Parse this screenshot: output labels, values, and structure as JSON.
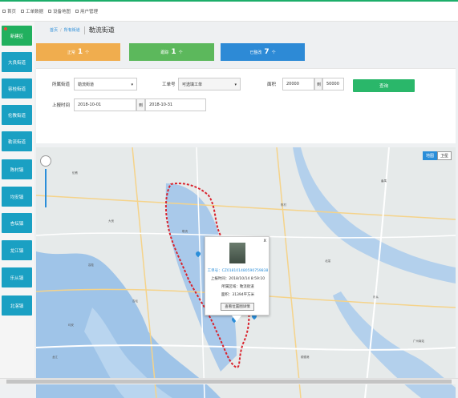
{
  "topbar": {
    "tabs": [
      {
        "label": "首页"
      },
      {
        "label": "工单数据"
      },
      {
        "label": "设备地图"
      },
      {
        "label": "用户管理"
      }
    ]
  },
  "sidebar": {
    "items": [
      {
        "label": "新建区"
      },
      {
        "label": "大良街道"
      },
      {
        "label": "容桂街道"
      },
      {
        "label": "伦教街道"
      },
      {
        "label": "勒流街道"
      },
      {
        "label": "陈村镇"
      },
      {
        "label": "均安镇"
      },
      {
        "label": "杏坛镇"
      },
      {
        "label": "龙江镇"
      },
      {
        "label": "乐从镇"
      },
      {
        "label": "北滘镇"
      }
    ]
  },
  "breadcrumb": {
    "home": "首页",
    "parent": "所有街道",
    "current": "勒流街道"
  },
  "stats": [
    {
      "label": "正常",
      "count": "1",
      "unit": "个",
      "color": "#f0ad4e"
    },
    {
      "label": "跟踪",
      "count": "1",
      "unit": "个",
      "color": "#5cb85c"
    },
    {
      "label": "已整改",
      "count": "7",
      "unit": "个",
      "color": "#2d8ad6"
    }
  ],
  "filters": {
    "street_label": "所属街道",
    "street_value": "勒流街道",
    "order_label": "工单号",
    "order_placeholder": "可选填工单",
    "area_label": "面积",
    "area_from": "20000",
    "area_to_sep": "到",
    "area_to": "50000",
    "query_button": "查询",
    "time_label": "上报时间",
    "time_from": "2018-10-01",
    "time_to_sep": "到",
    "time_to": "2018-10-31"
  },
  "map": {
    "type_options": [
      "地图",
      "卫星"
    ],
    "popup": {
      "close": "x",
      "work_order": "工单号：CZ018101480590759838",
      "report_time": "上报时间：2018/10/14 8:59:10",
      "district": "所属区域：勒流街道",
      "area": "面积：31394平方米",
      "button": "查看位置图详情"
    },
    "place_labels": [
      "伦教",
      "大良",
      "勒流",
      "容桂",
      "陈村",
      "北滘",
      "杏坛",
      "均安",
      "龙江",
      "乐从",
      "顺德港",
      "番禺",
      "广州南站"
    ]
  },
  "colors": {
    "sidebar_blue": "#1aa0c3",
    "sidebar_green": "#21b05e",
    "accent": "#2ab76a",
    "boundary": "#d9232d"
  }
}
